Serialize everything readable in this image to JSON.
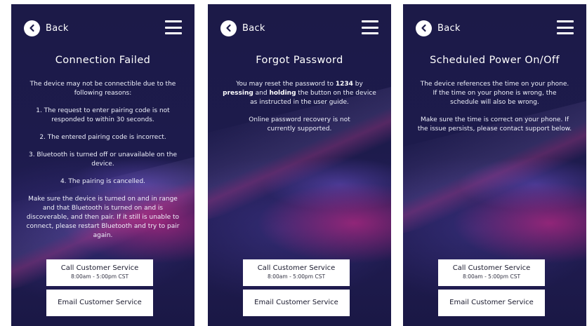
{
  "back_label": "Back",
  "screens": [
    {
      "title": "Connection Failed",
      "paragraphs": [
        "The device may not be connectible due to the following reasons:",
        "1. The request to enter pairing code is not responded to within 30 seconds.",
        "2. The entered pairing code is incorrect.",
        "3. Bluetooth is turned off or unavailable on the device.",
        "4. The pairing is cancelled.",
        "Make sure the device is turned on and in range and that Bluetooth is turned on and is discoverable, and then pair. If it still is unable to connect, please restart Bluetooth and try to pair again."
      ]
    },
    {
      "title": "Forgot Password",
      "rich": {
        "p1_a": "You may reset the password to ",
        "p1_code": "1234",
        "p1_b": " by ",
        "p1_press": "pressing",
        "p1_c": " and ",
        "p1_hold": "holding",
        "p1_d": " the button on the device as instructed in the user guide."
      },
      "paragraphs": [
        "Online password recovery is not currently supported."
      ]
    },
    {
      "title": "Scheduled Power On/Off",
      "paragraphs": [
        "The device references the time on your phone. If the time on your phone is wrong, the schedule will also be wrong.",
        "Make sure the time is correct on your phone. If the issue persists, please contact support below."
      ]
    }
  ],
  "buttons": {
    "call_label": "Call Customer Service",
    "call_hours": "8:00am - 5:00pm CST",
    "email_label": "Email Customer Service"
  },
  "icons": {
    "back": "chevron-left-icon",
    "menu": "hamburger-menu-icon"
  },
  "colors": {
    "background": "#1d1b4c",
    "button": "#ffffff"
  }
}
